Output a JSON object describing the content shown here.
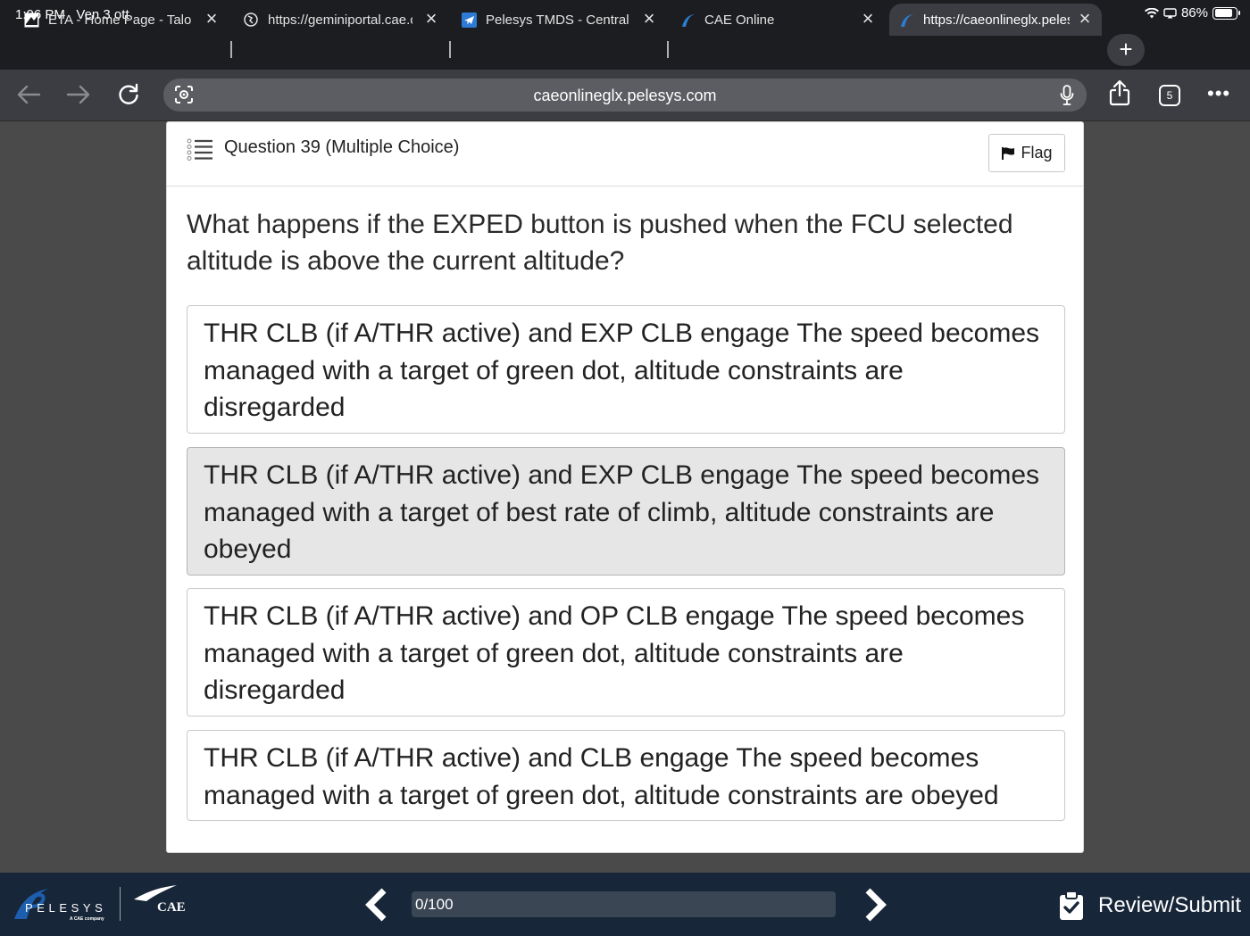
{
  "status_bar": {
    "time": "1:06 PM",
    "date": "Ven 3 ott",
    "battery": "86%",
    "battery_level": 0.86
  },
  "tabs": [
    {
      "title": "ETA - Home Page - Talon",
      "favicon": "eta-icon",
      "active": false
    },
    {
      "title": "https://geminiportal.cae.com",
      "favicon": "globe-icon",
      "active": false
    },
    {
      "title": "Pelesys TMDS - Central",
      "favicon": "plane-icon",
      "active": false
    },
    {
      "title": "CAE Online",
      "favicon": "pelesys-icon",
      "active": false
    },
    {
      "title": "https://caeonlineglx.pelesys.com",
      "favicon": "pelesys-icon",
      "active": true
    }
  ],
  "toolbar": {
    "url": "caeonlineglx.pelesys.com",
    "tab_count": "5",
    "more_label": "•••"
  },
  "quiz": {
    "question_title": "Question 39 (Multiple Choice)",
    "flag_label": "Flag",
    "question_text": "What happens if the EXPED button is pushed when the FCU selected altitude is above the current altitude?",
    "options": [
      {
        "text": "THR CLB (if A/THR active) and EXP CLB engage The speed becomes managed with a target of green dot, altitude constraints are disregarded",
        "selected": false
      },
      {
        "text": "THR CLB (if A/THR active) and EXP CLB engage The speed becomes managed with a target of best rate of climb, altitude constraints are obeyed",
        "selected": true
      },
      {
        "text": "THR CLB (if A/THR active) and OP CLB engage The speed becomes managed with a target of green dot, altitude constraints are disregarded",
        "selected": false
      },
      {
        "text": "THR CLB (if A/THR active) and CLB engage The speed becomes managed with a target of green dot, altitude constraints are obeyed",
        "selected": false
      }
    ]
  },
  "footer": {
    "brand_pelesys": "PELESYS",
    "brand_pelesys_sub": "A CAE company",
    "brand_cae": "CAE",
    "progress_text": "0/100",
    "progress_fraction": 0.0,
    "review_label": "Review/Submit"
  },
  "colors": {
    "page_background": "#4a4a4a",
    "footer_background": "#172638",
    "selected_option": "#e6e6e6",
    "pelesys_blue": "#1d5fae"
  }
}
